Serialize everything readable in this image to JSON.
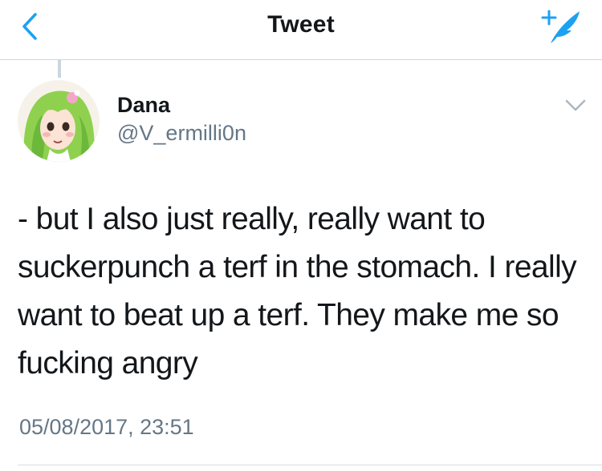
{
  "nav": {
    "title": "Tweet",
    "back_icon": "chevron-left-icon",
    "compose_icon": "compose-tweet-icon"
  },
  "tweet": {
    "author": {
      "display_name": "Dana",
      "handle": "@V_ermilli0n",
      "avatar_icon": "avatar-illustration"
    },
    "text": "- but I also just really, really want to suckerpunch a terf in the stomach. I really want to beat up a terf. They make me so fucking angry",
    "timestamp": "05/08/2017, 23:51",
    "menu_icon": "chevron-down-icon"
  },
  "colors": {
    "accent": "#1da1f2",
    "text": "#14171a",
    "secondary": "#657786",
    "divider": "#cfd4d9"
  }
}
